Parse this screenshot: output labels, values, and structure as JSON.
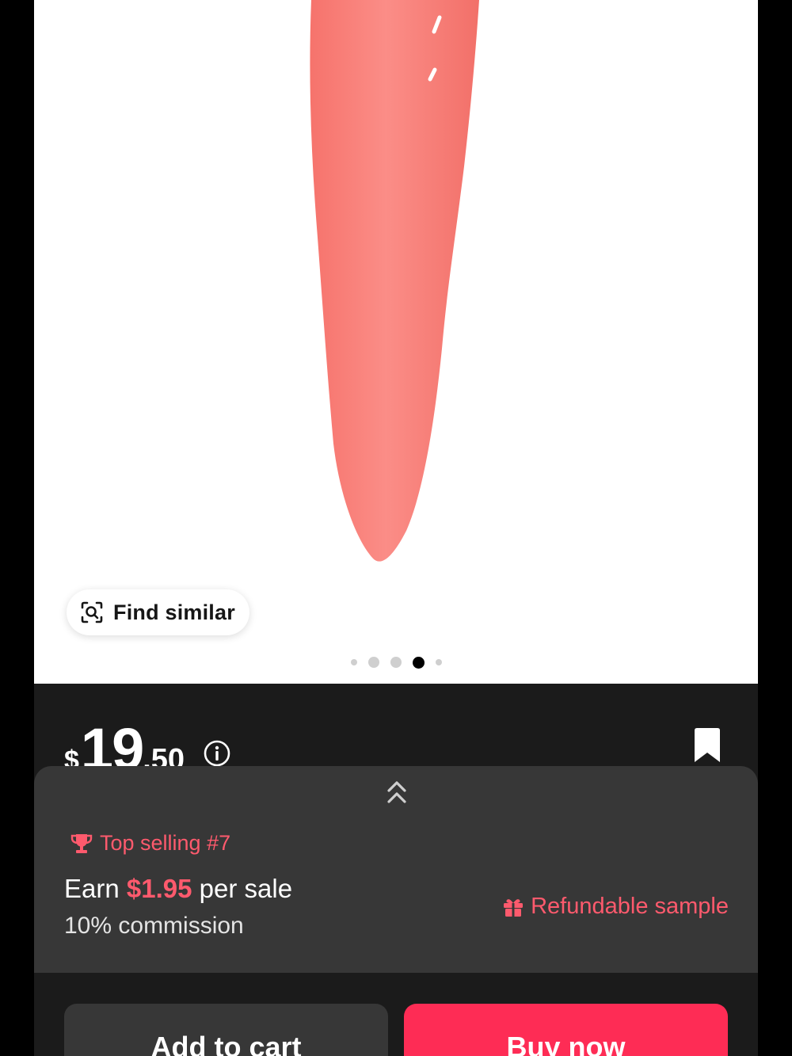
{
  "gallery": {
    "find_similar_label": "Find similar",
    "find_similar_icon": "image-search-icon",
    "dots_total": 5,
    "active_dot_index": 3
  },
  "price": {
    "currency": "$",
    "whole": "19",
    "decimal": ".50",
    "info_icon": "info-icon",
    "bookmark_icon": "bookmark-icon"
  },
  "affiliate": {
    "expand_icon": "double-chevron-up-icon",
    "top_selling": "Top selling #7",
    "earn_prefix": "Earn",
    "earn_amount": "$1.95",
    "earn_suffix": "per sale",
    "commission": "10% commission",
    "refundable_sample": "Refundable sample"
  },
  "actions": {
    "add_to_cart": "Add to cart",
    "buy_now": "Buy now"
  },
  "colors": {
    "accent": "#fe2c55",
    "accent_text": "#fe5a6d",
    "background": "#1b1b1b",
    "panel": "#373737",
    "product_pink": "#f7837c"
  }
}
